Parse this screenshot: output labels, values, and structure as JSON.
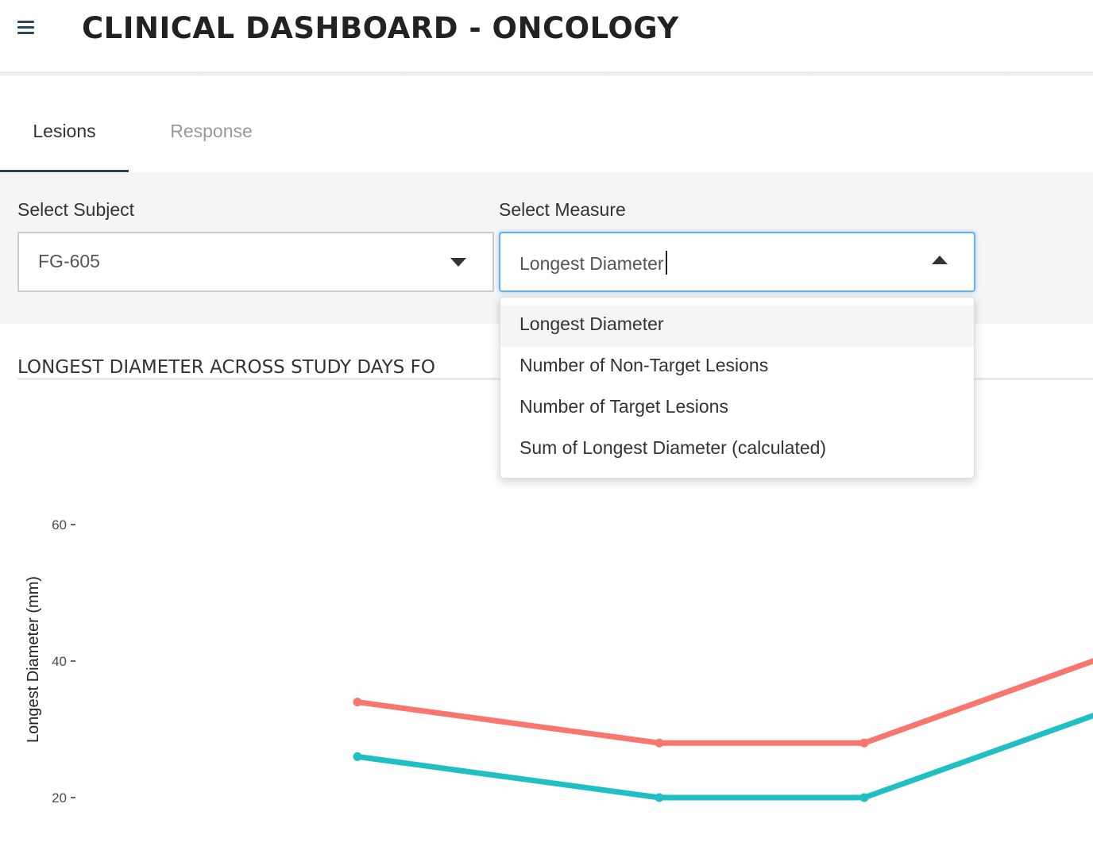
{
  "header": {
    "title": "CLINICAL DASHBOARD - ONCOLOGY",
    "menu_icon": "hamburger-menu-icon"
  },
  "tabs": [
    {
      "label": "Lesions",
      "active": true
    },
    {
      "label": "Response",
      "active": false
    }
  ],
  "controls": {
    "subject": {
      "label": "Select Subject",
      "value": "FG-605"
    },
    "measure": {
      "label": "Select Measure",
      "value": "Longest Diameter",
      "open": true,
      "options": [
        {
          "label": "Longest Diameter",
          "highlighted": true
        },
        {
          "label": "Number of Non-Target Lesions",
          "highlighted": false
        },
        {
          "label": "Number of Target Lesions",
          "highlighted": false
        },
        {
          "label": "Sum of Longest Diameter (calculated)",
          "highlighted": false
        }
      ]
    }
  },
  "colors": {
    "accent": "#2b4560",
    "focus": "#66afe9",
    "series_1": "#f8766d",
    "series_2": "#1fbfc3"
  },
  "chart_title": "LONGEST DIAMETER ACROSS STUDY DAYS FO",
  "chart_data": {
    "type": "line",
    "title": "LONGEST DIAMETER ACROSS STUDY DAYS FO",
    "ylabel": "Longest Diameter (mm)",
    "xlabel": "",
    "y_ticks": [
      "20",
      "40",
      "60"
    ],
    "ylim": [
      20,
      60
    ],
    "grid": false,
    "series": [
      {
        "color": "#f8766d",
        "points": [
          [
            1,
            34
          ],
          [
            2,
            28
          ],
          [
            3,
            28
          ],
          [
            4,
            41
          ]
        ]
      },
      {
        "color": "#1fbfc3",
        "points": [
          [
            1,
            26
          ],
          [
            2,
            20
          ],
          [
            3,
            20
          ],
          [
            4,
            33
          ]
        ]
      }
    ]
  }
}
